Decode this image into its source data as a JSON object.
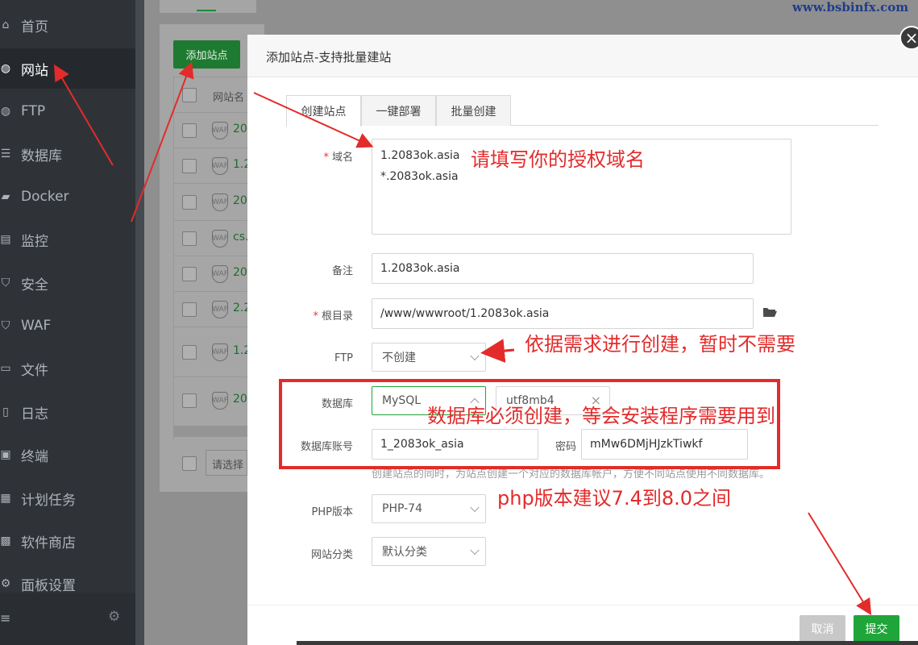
{
  "watermark": "www.bsbinfx.com",
  "sidebar": {
    "items": [
      {
        "label": "首页",
        "icon": "home-icon"
      },
      {
        "label": "网站",
        "icon": "globe-icon",
        "active": true
      },
      {
        "label": "FTP",
        "icon": "globe-icon"
      },
      {
        "label": "数据库",
        "icon": "database-icon"
      },
      {
        "label": "Docker",
        "icon": "docker-icon"
      },
      {
        "label": "监控",
        "icon": "monitor-icon"
      },
      {
        "label": "安全",
        "icon": "shield-icon"
      },
      {
        "label": "WAF",
        "icon": "waf-shield-icon"
      },
      {
        "label": "文件",
        "icon": "folder-icon"
      },
      {
        "label": "日志",
        "icon": "log-icon"
      },
      {
        "label": "终端",
        "icon": "terminal-icon"
      },
      {
        "label": "计划任务",
        "icon": "calendar-icon"
      },
      {
        "label": "软件商店",
        "icon": "store-icon"
      },
      {
        "label": "面板设置",
        "icon": "gear-icon"
      }
    ]
  },
  "background": {
    "add_site_label": "添加站点",
    "table_header": "网站名",
    "waf_label": "WAF",
    "rows": [
      "20",
      "1.2",
      "20",
      "cs.",
      "20",
      "2.2",
      "1.2",
      "20"
    ],
    "batch_select_placeholder": "请选择"
  },
  "modal": {
    "title": "添加站点-支持批量建站",
    "tabs": [
      "创建站点",
      "一键部署",
      "批量创建"
    ],
    "form": {
      "domain_label": "域名",
      "domain_lines": [
        "1.2083ok.asia",
        "*.2083ok.asia"
      ],
      "remark_label": "备注",
      "remark_value": "1.2083ok.asia",
      "root_label": "根目录",
      "root_value": "/www/wwwroot/1.2083ok.asia",
      "ftp_label": "FTP",
      "ftp_value": "不创建",
      "db_label": "数据库",
      "db_type": "MySQL",
      "db_charset": "utf8mb4",
      "db_account_label": "数据库账号",
      "db_account_value": "1_2083ok_asia",
      "password_label": "密码",
      "password_value": "mMw6DMjHJzkTiwkf",
      "db_hint": "创建站点的同时，为站点创建一个对应的数据库帐户，方便不同站点使用不同数据库。",
      "php_label": "PHP版本",
      "php_value": "PHP-74",
      "category_label": "网站分类",
      "category_value": "默认分类"
    },
    "cancel_label": "取消",
    "submit_label": "提交"
  },
  "annotations": {
    "domain_note": "请填写你的授权域名",
    "ftp_note": "依据需求进行创建，暂时不需要",
    "db_note": "数据库必须创建，等会安装程序需要用到",
    "php_note": "php版本建议7.4到8.0之间"
  },
  "colors": {
    "accent": "#20a53a",
    "annotation": "#e32b2b",
    "sidebar_bg": "#2f3338"
  }
}
